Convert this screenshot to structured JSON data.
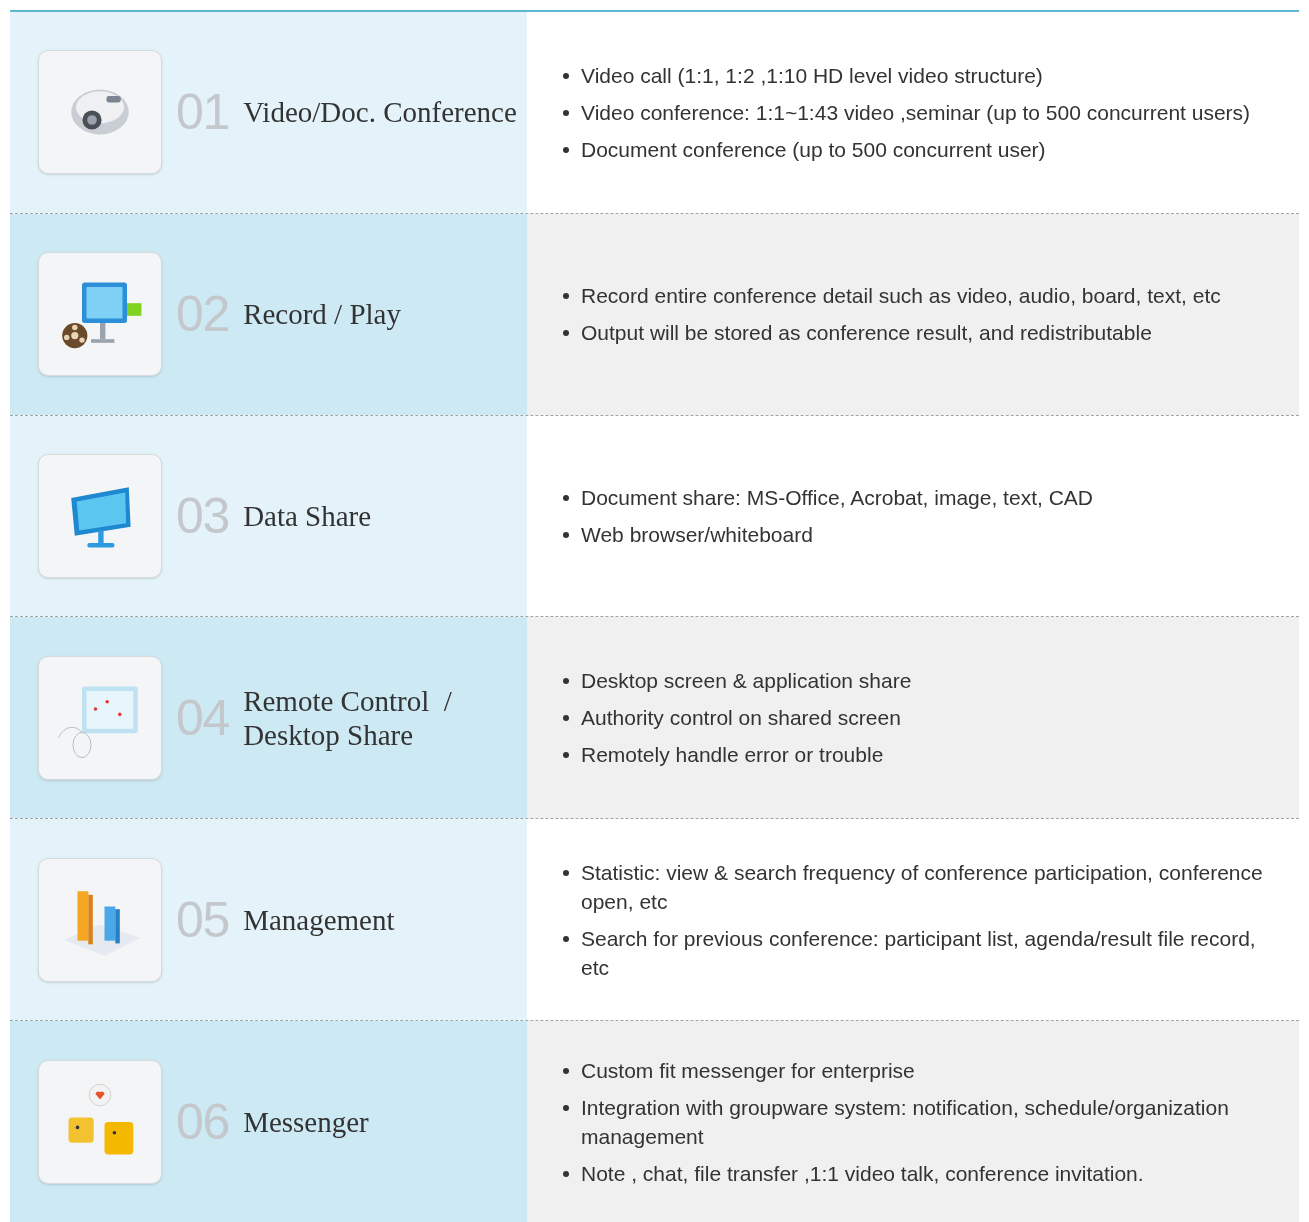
{
  "rows": [
    {
      "number": "01",
      "title_lines": [
        "Video/Doc. Conference"
      ],
      "kind": "projector",
      "bullets": [
        "Video call (1:1, 1:2 ,1:10 HD level video structure)",
        "Video conference: 1:1~1:43 video ,seminar (up to 500 concurrent users)",
        "Document conference (up to 500 concurrent user)"
      ]
    },
    {
      "number": "02",
      "title_lines": [
        "Record / Play"
      ],
      "kind": "monitor-reel",
      "bullets": [
        "Record entire conference detail such as video, audio, board, text, etc",
        "Output will be stored as conference result, and redistributable"
      ]
    },
    {
      "number": "03",
      "title_lines": [
        "Data Share"
      ],
      "kind": "monitor-data",
      "bullets": [
        "Document share: MS-Office, Acrobat, image, text, CAD",
        "Web browser/whiteboard"
      ]
    },
    {
      "number": "04",
      "title_lines": [
        "Remote Control  /",
        "Desktop Share"
      ],
      "kind": "screen-mouse",
      "bullets": [
        "Desktop screen & application share",
        "Authority control on shared screen",
        "Remotely handle error or trouble"
      ]
    },
    {
      "number": "05",
      "title_lines": [
        "Management"
      ],
      "kind": "bar-chart",
      "bullets": [
        "Statistic: view & search frequency of conference participation, conference open, etc",
        "Search for previous conference: participant list, agenda/result file record, etc"
      ]
    },
    {
      "number": "06",
      "title_lines": [
        "Messenger"
      ],
      "kind": "people-chat",
      "bullets": [
        "Custom fit messenger for enterprise",
        "Integration with groupware system: notification, schedule/organization management",
        "Note , chat, file transfer ,1:1 video talk, conference invitation."
      ]
    }
  ]
}
